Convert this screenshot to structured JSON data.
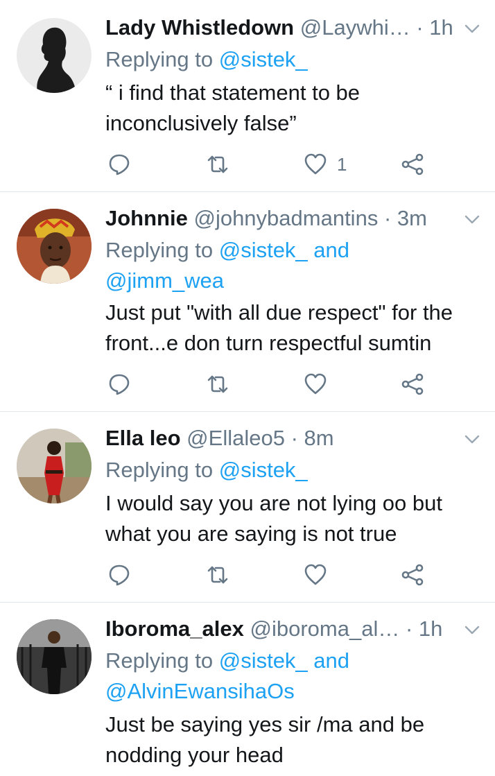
{
  "tweets": [
    {
      "name": "Lady Whistledown",
      "handle": "@Laywhi…",
      "dot": "·",
      "time": "1h",
      "replying": [
        "Replying to ",
        "@sistek_",
        "",
        ""
      ],
      "lines": [
        "“ i find that statement to be",
        "inconclusively false”"
      ],
      "like_count": "1",
      "avatar": "silhouette"
    },
    {
      "name": "Johnnie",
      "handle": "@johnybadmantins",
      "dot": "·",
      "time": "3m",
      "replying": [
        "Replying to ",
        "@sistek_",
        " and",
        "@jimm_wea"
      ],
      "lines": [
        "Just put \"with all due respect\" for the",
        "front...e don turn respectful sumtin"
      ],
      "like_count": "",
      "avatar": "man-headwear"
    },
    {
      "name": "Ella leo",
      "handle": "@Ellaleo5",
      "dot": "·",
      "time": "8m",
      "replying": [
        "Replying to ",
        "@sistek_",
        "",
        ""
      ],
      "lines": [
        "I would say you are not lying oo but",
        "what you are saying is not true"
      ],
      "like_count": "",
      "avatar": "woman-red-dress"
    },
    {
      "name": "Iboroma_alex",
      "handle": "@iboroma_al…",
      "dot": "·",
      "time": "1h",
      "replying": [
        "Replying to ",
        "@sistek_",
        " and",
        "@AlvinEwansihaOs"
      ],
      "lines": [
        "Just be saying yes sir /ma and be",
        "nodding your head"
      ],
      "like_count": "",
      "avatar": "man-standing"
    }
  ],
  "icons": {
    "reply": "reply-icon",
    "retweet": "retweet-icon",
    "like": "heart-icon",
    "share": "share-icon",
    "caret": "chevron-down-icon"
  },
  "colors": {
    "text": "#14171a",
    "secondary": "#657786",
    "link": "#1da1f2",
    "divider": "#e1e8ed"
  }
}
